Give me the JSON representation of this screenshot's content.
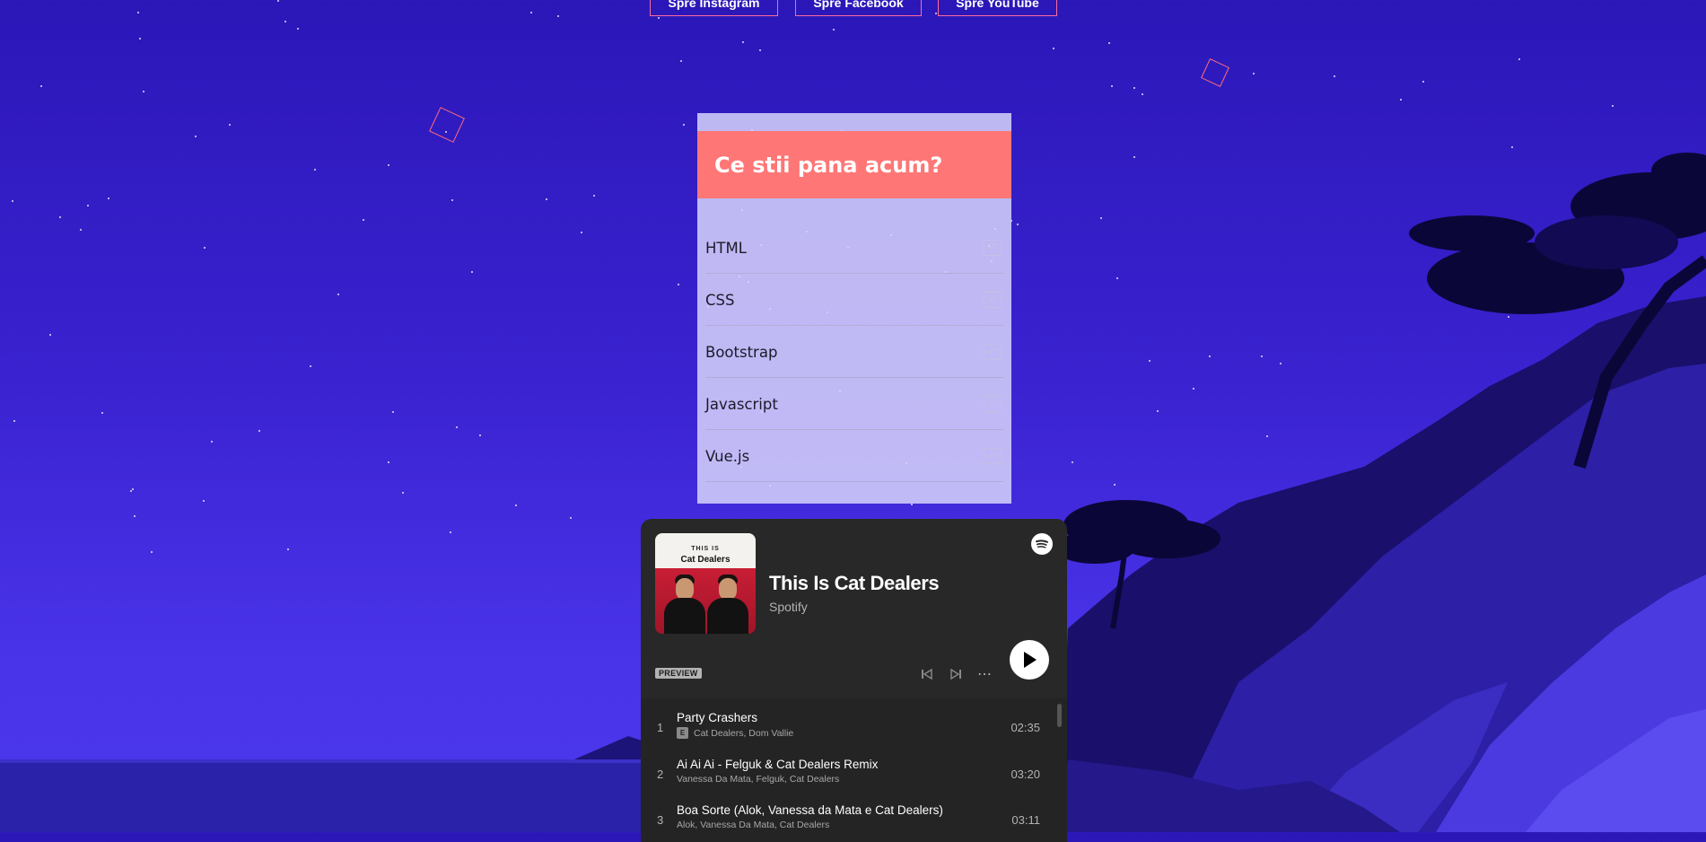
{
  "social": {
    "instagram": "Spre Instagram",
    "facebook": "Spre Facebook",
    "youtube": "Spre YouTube"
  },
  "skills_card": {
    "title": "Ce stii pana acum?",
    "items": [
      {
        "label": "HTML",
        "checked": true
      },
      {
        "label": "CSS",
        "checked": true
      },
      {
        "label": "Bootstrap",
        "checked": true
      },
      {
        "label": "Javascript",
        "checked": true
      },
      {
        "label": "Vue.js",
        "checked": true
      }
    ]
  },
  "player": {
    "cover_small": "THIS IS",
    "cover_name": "Cat Dealers",
    "title": "This Is Cat Dealers",
    "subtitle": "Spotify",
    "preview_label": "PREVIEW",
    "icons": {
      "prev": "skip-back-icon",
      "next": "skip-forward-icon",
      "more": "more-icon",
      "play": "play-icon",
      "logo": "spotify-logo-icon"
    },
    "tracks": [
      {
        "num": "1",
        "title": "Party Crashers",
        "explicit": "E",
        "artists": "Cat Dealers, Dom Vallie",
        "duration": "02:35"
      },
      {
        "num": "2",
        "title": "Ai Ai Ai - Felguk & Cat Dealers Remix",
        "explicit": "",
        "artists": "Vanessa Da Mata, Felguk, Cat Dealers",
        "duration": "03:20"
      },
      {
        "num": "3",
        "title": "Boa Sorte (Alok, Vanessa da Mata e Cat Dealers)",
        "explicit": "",
        "artists": "Alok, Vanessa Da Mata, Cat Dealers",
        "duration": "03:11"
      }
    ]
  },
  "colors": {
    "sky_top": "#2b17b8",
    "sky_bottom": "#4b37ec",
    "card_header": "#ff7676",
    "accent_border": "#ff6b9a",
    "player_bg": "#282828"
  }
}
